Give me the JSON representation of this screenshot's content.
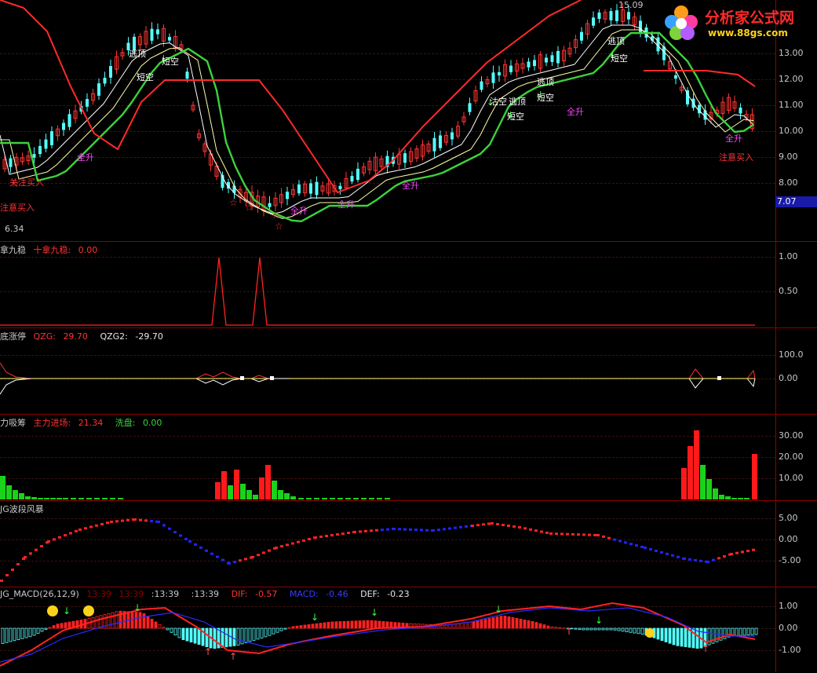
{
  "main": {
    "price_high_label": "15.09",
    "price_low_label": "6.34",
    "current_price": "7.07",
    "axis_ticks": [
      "13.00",
      "12.00",
      "11.00",
      "10.00",
      "9.00",
      "8.00"
    ],
    "signals": {
      "escape_top": "逃顶",
      "short_empty": "短空",
      "full_rise": "全升",
      "attention_buy": "关注买入",
      "caution_buy": "注意买入",
      "big_empty": "沽空"
    }
  },
  "logo": {
    "title": "分析家公式网",
    "url": "www.88gs.com"
  },
  "panel1": {
    "title": "拿九稳",
    "series_label": "十拿九稳:",
    "series_value": "0.00",
    "ticks": [
      "1.00",
      "0.50"
    ]
  },
  "panel2": {
    "title": "底涨停",
    "qzg_label": "QZG:",
    "qzg_value": "29.70",
    "qzg2_label": "QZG2:",
    "qzg2_value": "-29.70",
    "ticks": [
      "100.0",
      "0.00"
    ]
  },
  "panel3": {
    "title": "力吸筹",
    "main_label": "主力进场:",
    "main_value": "21.34",
    "wash_label": "洗盘:",
    "wash_value": "0.00",
    "ticks": [
      "30.00",
      "20.00",
      "10.00"
    ]
  },
  "panel4": {
    "title": "JG波段风暴",
    "ticks": [
      "5.00",
      "0.00",
      "-5.00"
    ]
  },
  "panel5": {
    "title": "JG_MACD(26,12,9)",
    "time1": "13:39",
    "time2": "13:39",
    "time3": "13:39",
    "time4": "13:39",
    "dif_label": "DIF:",
    "dif_value": "-0.57",
    "macd_label": "MACD:",
    "macd_value": "-0.46",
    "def_label": "DEF:",
    "def_value": "-0.23",
    "ticks": [
      "1.00",
      "0.00",
      "-1.00"
    ]
  },
  "colors": {
    "up": "#ff3333",
    "down": "#54ffff",
    "bg": "#000000",
    "axis": "#8b0000",
    "green": "#3cd23c",
    "blue": "#2323ff"
  }
}
